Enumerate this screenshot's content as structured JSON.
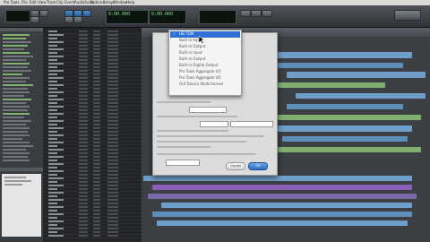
{
  "menubar": {
    "items": [
      "Pro Tools",
      "File",
      "Edit",
      "View",
      "Track",
      "Clip",
      "Event",
      "AudioSuite",
      "Options",
      "Setup",
      "Window",
      "Help"
    ]
  },
  "transport": {
    "counter_main": "0:00.000",
    "counter_sub": "0:00.000"
  },
  "dropdown": {
    "options": [
      {
        "label": "HD TDM",
        "selected": true
      },
      {
        "label": "Built-in Input"
      },
      {
        "label": "Built-in Output"
      },
      {
        "label": "Built-in Input"
      },
      {
        "label": "Built-in Output"
      },
      {
        "label": "Built-in Digital Output"
      },
      {
        "label": "Pro Tools Aggregate I/O"
      },
      {
        "label": "Pro Tools Aggregate I/O"
      },
      {
        "label": "Out Device Multichannel"
      }
    ]
  },
  "dialog": {
    "ok_label": "OK",
    "cancel_label": "Cancel"
  },
  "colors": {
    "accent_blue": "#2f6fd6",
    "clip_blue": "#6f9fc8",
    "clip_purple": "#8b5fb5",
    "clip_green": "#7fb06f"
  }
}
